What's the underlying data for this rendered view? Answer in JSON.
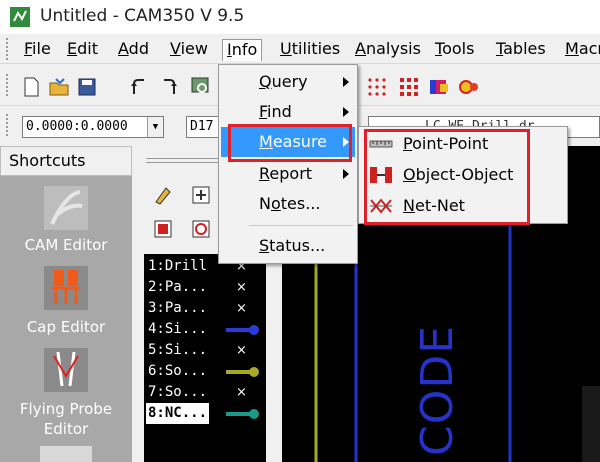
{
  "window": {
    "title": "Untitled - CAM350 V 9.5"
  },
  "menubar": {
    "items": [
      {
        "label": "File",
        "underline": "F",
        "rest": "ile"
      },
      {
        "label": "Edit",
        "underline": "E",
        "rest": "dit"
      },
      {
        "label": "Add",
        "underline": "A",
        "rest": "dd"
      },
      {
        "label": "View",
        "underline": "V",
        "rest": "iew"
      },
      {
        "label": "Info",
        "underline": "I",
        "rest": "nfo"
      },
      {
        "label": "Utilities",
        "underline": "U",
        "rest": "tilities"
      },
      {
        "label": "Analysis",
        "underline": "A",
        "rest": "nalysis"
      },
      {
        "label": "Tools",
        "underline": "T",
        "rest": "ools"
      },
      {
        "label": "Tables",
        "underline": "T",
        "rest": "ables"
      },
      {
        "label": "Macr",
        "underline": "M",
        "rest": "acr"
      }
    ]
  },
  "toolbar2": {
    "coordinates": "0.0000:0.0000",
    "layer": "D17",
    "path": "LC-WE-Drill.dr"
  },
  "info_menu": {
    "items": [
      {
        "label": "Query",
        "u": "Q",
        "rest": "uery",
        "submenu": true
      },
      {
        "label": "Find",
        "u": "F",
        "rest": "ind",
        "submenu": true
      },
      {
        "label": "Measure",
        "u": "M",
        "rest": "easure",
        "submenu": true,
        "highlighted": true
      },
      {
        "label": "Report",
        "u": "R",
        "rest": "eport",
        "submenu": true
      },
      {
        "label": "Notes...",
        "pre": "N",
        "u": "o",
        "rest": "tes..."
      },
      {
        "label": "Status...",
        "u": "S",
        "rest": "tatus..."
      }
    ]
  },
  "measure_submenu": {
    "items": [
      {
        "label": "Point-Point",
        "u": "P",
        "rest": "oint-Point",
        "icon": "point-point-icon"
      },
      {
        "label": "Object-Object",
        "u": "O",
        "rest": "bject-Object",
        "icon": "object-object-icon"
      },
      {
        "label": "Net-Net",
        "u": "N",
        "rest": "et-Net",
        "icon": "net-net-icon"
      }
    ]
  },
  "shortcuts": {
    "header": "Shortcuts",
    "items": [
      {
        "line1": "CAM Editor",
        "line2": ""
      },
      {
        "line1": "Cap Editor",
        "line2": ""
      },
      {
        "line1": "Flying Probe",
        "line2": "Editor"
      }
    ]
  },
  "layers": [
    {
      "label": "1:Drill",
      "mark": "×",
      "active": false
    },
    {
      "label": "2:Pa...",
      "mark": "×",
      "active": false
    },
    {
      "label": "3:Pa...",
      "mark": "×",
      "active": false
    },
    {
      "label": "4:Si...",
      "swatch": "#2a3bd6",
      "active": false
    },
    {
      "label": "5:Si...",
      "mark": "×",
      "active": false
    },
    {
      "label": "6:So...",
      "swatch": "#a8a822",
      "active": false
    },
    {
      "label": "7:So...",
      "mark": "×",
      "active": false
    },
    {
      "label": "8:NC...",
      "swatch": "#1a9a8a",
      "active": true
    }
  ],
  "canvas": {
    "text": "CODE"
  },
  "colors": {
    "highlight": "#3399ff",
    "annotation_red": "#e0202a",
    "canvas_bg": "#000000"
  }
}
